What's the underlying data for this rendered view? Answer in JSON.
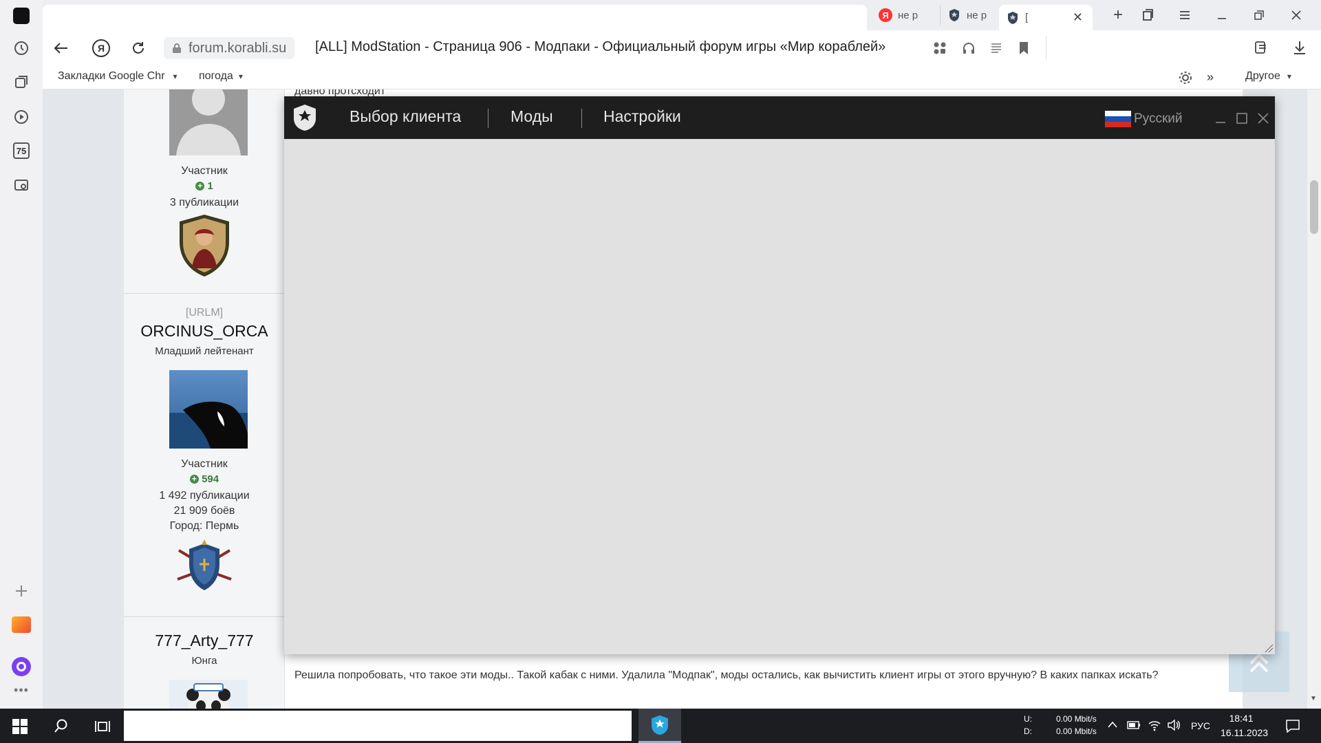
{
  "browser": {
    "tabs": [
      {
        "label": "не р",
        "icon": "yandex-icon"
      },
      {
        "label": "не р",
        "icon": "korabli-icon"
      },
      {
        "label": "[",
        "icon": "korabli-icon"
      }
    ],
    "url": "forum.korabli.su",
    "page_title": "[ALL] ModStation - Страница 906 - Модпаки - Официальный форум игры «Мир кораблей»",
    "bookmarks": [
      {
        "label": "Закладки Google Chr"
      },
      {
        "label": "погода"
      }
    ],
    "other_bookmarks": "Другое",
    "sidebar_counter": "75"
  },
  "forum": {
    "top_cut_text": "давно протсходит",
    "user1": {
      "role": "Участник",
      "rep": "1",
      "posts": "3 публикации"
    },
    "user2": {
      "tag": "[URLM]",
      "name": "ORCINUS_ORCA",
      "rank": "Младший лейтенант",
      "role": "Участник",
      "rep": "594",
      "posts": "1 492 публикации",
      "battles": "21 909 боёв",
      "city": "Город: Пермь"
    },
    "user3": {
      "name": "777_Arty_777",
      "rank": "Юнга"
    },
    "post_text": "Решила попробовать, что такое эти моды.. Такой кабак с ними. Удалила \"Модпак\", моды остались, как вычистить клиент игры от этого вручную? В каких папках искать?"
  },
  "modstation": {
    "menu": [
      "Выбор клиента",
      "Моды",
      "Настройки"
    ],
    "language": "Русский"
  },
  "taskbar": {
    "upload_label": "U:",
    "download_label": "D:",
    "upload_speed": "0.00 Mbit/s",
    "download_speed": "0.00 Mbit/s",
    "lang": "РУС",
    "time": "18:41",
    "date": "16.11.2023"
  },
  "colors": {
    "accent_blue": "#2aa7e0",
    "mod_header": "#1e1e1e",
    "mod_body": "#e1e1e1",
    "rep_green": "#3a7a3a"
  }
}
